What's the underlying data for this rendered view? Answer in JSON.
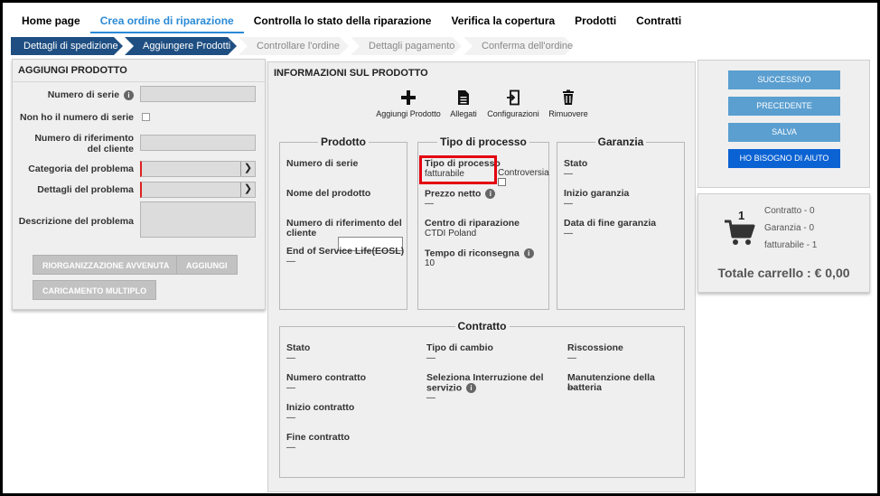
{
  "nav": {
    "tabs": [
      {
        "label": "Home page"
      },
      {
        "label": "Crea ordine di riparazione"
      },
      {
        "label": "Controlla lo stato della riparazione"
      },
      {
        "label": "Verifica la copertura"
      },
      {
        "label": "Prodotti"
      },
      {
        "label": "Contratti"
      }
    ],
    "active_index": 1
  },
  "stepper": {
    "steps": [
      {
        "label": "Dettagli di spedizione",
        "state": "done"
      },
      {
        "label": "Aggiungere Prodotti",
        "state": "done"
      },
      {
        "label": "Controllare l'ordine",
        "state": "pending"
      },
      {
        "label": "Dettagli pagamento",
        "state": "pending"
      },
      {
        "label": "Conferma dell'ordine",
        "state": "pending"
      }
    ]
  },
  "add_product": {
    "title": "AGGIUNGI PRODOTTO",
    "serial_label": "Numero di serie",
    "no_serial_label": "Non ho il numero di serie",
    "customer_ref_label": "Numero di riferimento del cliente",
    "problem_category_label": "Categoria del problema",
    "problem_details_label": "Dettagli del problema",
    "problem_description_label": "Descrizione del problema",
    "reorg_button": "RIORGANIZZAZIONE AVVENUTA",
    "add_button": "AGGIUNGI",
    "bulk_upload_button": "CARICAMENTO MULTIPLO"
  },
  "product_info": {
    "title": "INFORMAZIONI SUL PRODOTTO",
    "toolbar": {
      "add_product": "Aggiungi Prodotto",
      "attachments": "Allegati",
      "configurations": "Configurazioni",
      "remove": "Rimuovere"
    },
    "product_box": {
      "title": "Prodotto",
      "serial_label": "Numero di serie",
      "name_label": "Nome del prodotto",
      "customer_ref_label": "Numero di riferimento del cliente",
      "eosl_label": "End of Service Life(EOSL)",
      "eosl_value": "—"
    },
    "process_box": {
      "title": "Tipo di processo",
      "process_type_label": "Tipo di processo",
      "process_type_value": "fatturabile",
      "dispute_label": "Controversia",
      "net_price_label": "Prezzo netto",
      "net_price_value": "—",
      "repair_center_label": "Centro di riparazione",
      "repair_center_value": "CTDI Poland",
      "return_time_label": "Tempo di riconsegna",
      "return_time_value": "10"
    },
    "warranty_box": {
      "title": "Garanzia",
      "status_label": "Stato",
      "status_value": "—",
      "start_label": "Inizio garanzia",
      "start_value": "—",
      "end_label": "Data di fine garanzia",
      "end_value": "—"
    },
    "contract_box": {
      "title": "Contratto",
      "status_label": "Stato",
      "status_value": "—",
      "exchange_type_label": "Tipo di cambio",
      "exchange_type_value": "—",
      "collection_label": "Riscossione",
      "collection_value": "—",
      "contract_number_label": "Numero contratto",
      "contract_number_value": "—",
      "service_interruption_label": "Seleziona Interruzione del servizio",
      "service_interruption_value": "—",
      "battery_maintenance_label": "Manutenzione della batteria",
      "battery_maintenance_value": "—",
      "contract_start_label": "Inizio contratto",
      "contract_start_value": "—",
      "contract_end_label": "Fine contratto",
      "contract_end_value": "—"
    }
  },
  "actions": {
    "next": "SUCCESSIVO",
    "previous": "PRECEDENTE",
    "save": "SALVA",
    "help": "HO BISOGNO DI AIUTO"
  },
  "cart": {
    "count": "1",
    "contract_line": "Contratto - 0",
    "warranty_line": "Garanzia - 0",
    "billable_line": "fatturabile - 1",
    "total": "Totale carrello : € 0,00"
  },
  "colors": {
    "accent": "#2a8ad6",
    "step_done": "#1f4f82",
    "button_blue": "#5b9fd0",
    "button_primary": "#0b62d3",
    "highlight": "#e3000f"
  }
}
